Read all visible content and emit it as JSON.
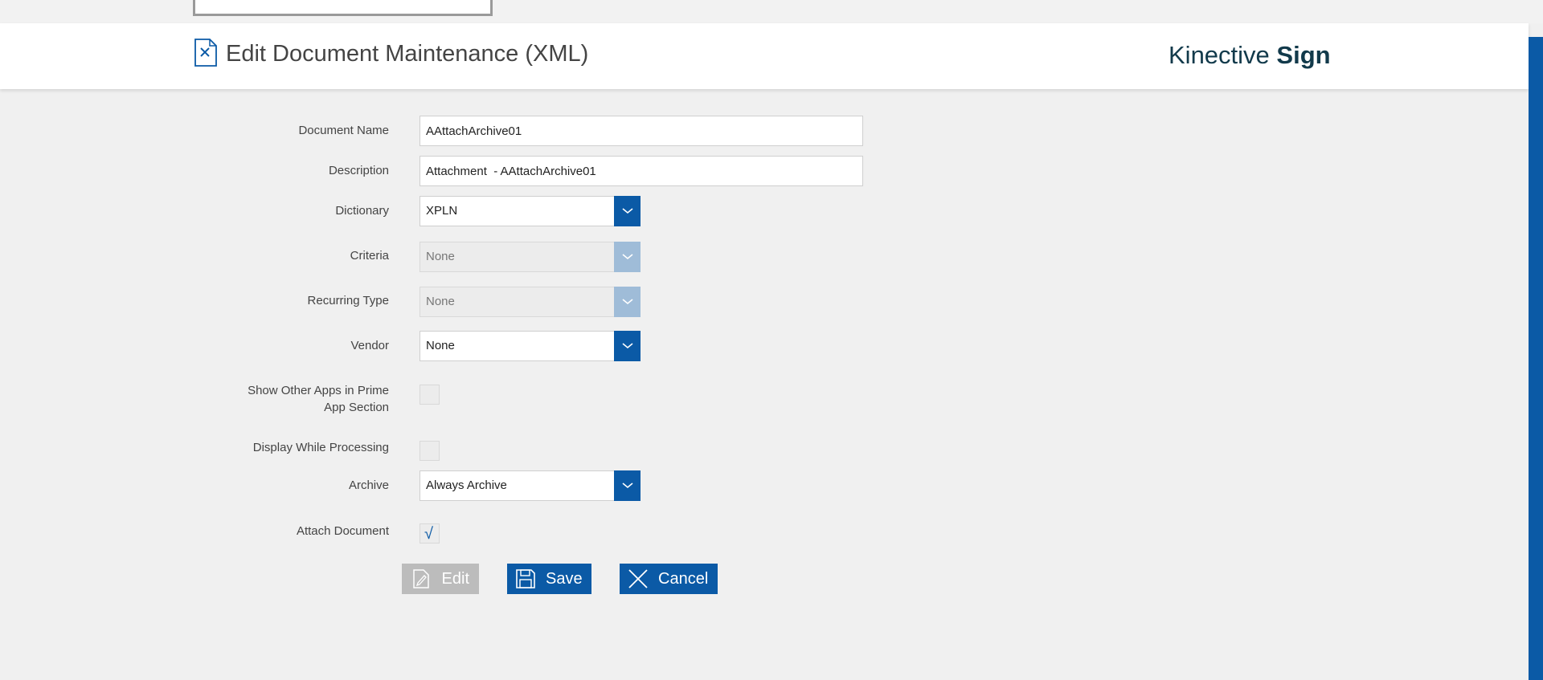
{
  "header": {
    "title": "Edit Document Maintenance (XML)",
    "brand_light": "Kinective ",
    "brand_bold": "Sign"
  },
  "form": {
    "document_name": {
      "label": "Document Name",
      "value": "AAttachArchive01"
    },
    "description": {
      "label": "Description",
      "value": "Attachment  - AAttachArchive01"
    },
    "dictionary": {
      "label": "Dictionary",
      "value": "XPLN"
    },
    "criteria": {
      "label": "Criteria",
      "value": "None"
    },
    "recurring_type": {
      "label": "Recurring Type",
      "value": "None"
    },
    "vendor": {
      "label": "Vendor",
      "value": "None"
    },
    "show_other_apps": {
      "label_line1": "Show Other Apps in Prime",
      "label_line2": "App Section",
      "checked": false
    },
    "display_while_processing": {
      "label": "Display While Processing",
      "checked": false
    },
    "archive": {
      "label": "Archive",
      "value": "Always Archive"
    },
    "attach_document": {
      "label": "Attach Document",
      "checked": true,
      "mark": "√"
    }
  },
  "buttons": {
    "edit": "Edit",
    "save": "Save",
    "cancel": "Cancel"
  },
  "colors": {
    "accent": "#0b5aa6",
    "accent_disabled": "#9fbcd8",
    "brand_text": "#123a4b",
    "button_disabled": "#bcbcbc"
  },
  "icons": {
    "title": "document-x-icon",
    "dropdown": "chevron-down-icon",
    "edit": "edit-icon",
    "save": "floppy-disk-icon",
    "cancel": "close-icon"
  }
}
